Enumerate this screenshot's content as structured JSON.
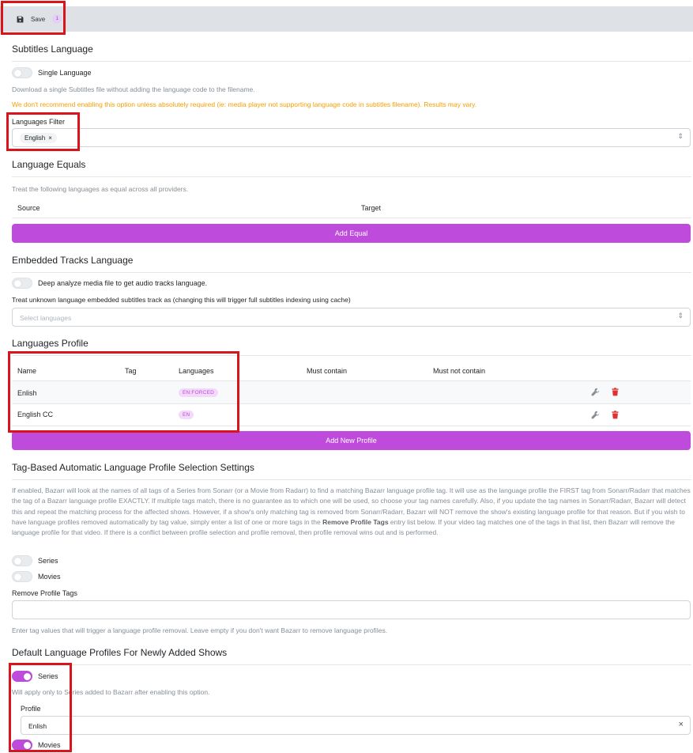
{
  "toolbar": {
    "save_label": "Save",
    "save_badge": "1"
  },
  "subtitles_language": {
    "title": "Subtitles Language",
    "single_language_label": "Single Language",
    "single_language_desc": "Download a single Subtitles file without adding the language code to the filename.",
    "warning": "We don't recommend enabling this option unless absolutely required (ie: media player not supporting language code in subtitles filename). Results may vary.",
    "filter_label": "Languages Filter",
    "filter_chip": "English"
  },
  "language_equals": {
    "title": "Language Equals",
    "desc": "Treat the following languages as equal across all providers.",
    "col_source": "Source",
    "col_target": "Target",
    "add_button": "Add Equal"
  },
  "embedded": {
    "title": "Embedded Tracks Language",
    "deep_analyze_label": "Deep analyze media file to get audio tracks language.",
    "unknown_label": "Treat unknown language embedded subtitles track as (changing this will trigger full subtitles indexing using cache)",
    "unknown_placeholder": "Select languages"
  },
  "profiles": {
    "title": "Languages Profile",
    "headers": {
      "name": "Name",
      "tag": "Tag",
      "languages": "Languages",
      "must_contain": "Must contain",
      "must_not_contain": "Must not contain"
    },
    "rows": [
      {
        "name": "Enlish",
        "tag": "",
        "languages": "EN:FORCED"
      },
      {
        "name": "English CC",
        "tag": "",
        "languages": "EN"
      }
    ],
    "add_button": "Add New Profile"
  },
  "tag_based": {
    "title": "Tag-Based Automatic Language Profile Selection Settings",
    "desc_part1": "If enabled, Bazarr will look at the names of all tags of a Series from Sonarr (or a Movie from Radarr) to find a matching Bazarr language profile tag. It will use as the language profile the FIRST tag from Sonarr/Radarr that matches the tag of a Bazarr language profile EXACTLY. If multiple tags match, there is no guarantee as to which one will be used, so choose your tag names carefully. Also, if you update the tag names in Sonarr/Radarr, Bazarr will detect this and repeat the matching process for the affected shows. However, if a show's only matching tag is removed from Sonarr/Radarr, Bazarr will NOT remove the show's existing language profile for that reason. But if you wish to have language profiles removed automatically by tag value, simply enter a list of one or more tags in the ",
    "desc_bold": "Remove Profile Tags",
    "desc_part2": " entry list below. If your video tag matches one of the tags in that list, then Bazarr will remove the language profile for that video. If there is a conflict between profile selection and profile removal, then profile removal wins out and is performed.",
    "series_label": "Series",
    "movies_label": "Movies",
    "remove_tags_label": "Remove Profile Tags",
    "remove_tags_desc": "Enter tag values that will trigger a language profile removal. Leave empty if you don't want Bazarr to remove language profiles."
  },
  "defaults": {
    "title": "Default Language Profiles For Newly Added Shows",
    "series_label": "Series",
    "series_desc": "Will apply only to Series added to Bazarr after enabling this option.",
    "profile_label": "Profile",
    "profile_value": "Enlish",
    "movies_label": "Movies"
  },
  "colors": {
    "accent": "#be4bdb",
    "warning": "#f59f00",
    "highlight": "#d9151b",
    "delete": "#e03131"
  }
}
